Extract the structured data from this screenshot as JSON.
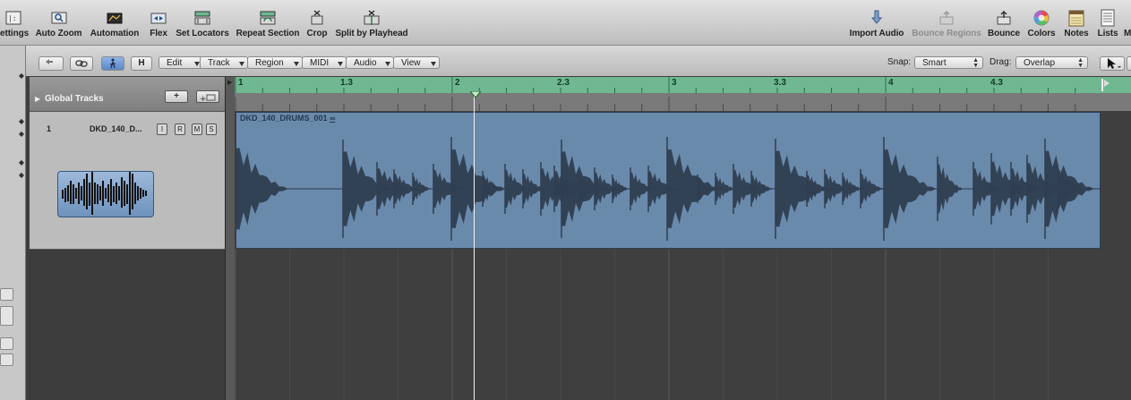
{
  "toolbar": {
    "items": [
      {
        "label": "ettings",
        "icon": "settings-icon"
      },
      {
        "label": "Auto Zoom",
        "icon": "auto-zoom-icon"
      },
      {
        "label": "Automation",
        "icon": "automation-icon"
      },
      {
        "label": "Flex",
        "icon": "flex-icon"
      },
      {
        "label": "Set Locators",
        "icon": "set-locators-icon"
      },
      {
        "label": "Repeat Section",
        "icon": "repeat-section-icon"
      },
      {
        "label": "Crop",
        "icon": "crop-icon"
      },
      {
        "label": "Split by Playhead",
        "icon": "split-icon"
      },
      {
        "label": "Import Audio",
        "icon": "import-audio-icon"
      },
      {
        "label": "Bounce Regions",
        "icon": "bounce-regions-icon"
      },
      {
        "label": "Bounce",
        "icon": "bounce-icon"
      },
      {
        "label": "Colors",
        "icon": "colors-icon"
      },
      {
        "label": "Notes",
        "icon": "notes-icon"
      },
      {
        "label": "Lists",
        "icon": "lists-icon"
      },
      {
        "label": "M",
        "icon": "media-icon"
      }
    ]
  },
  "secondary": {
    "h_label": "H",
    "menus": [
      "Edit",
      "Track",
      "Region",
      "MIDI",
      "Audio",
      "View"
    ],
    "snap_label": "Snap:",
    "snap_value": "Smart",
    "drag_label": "Drag:",
    "drag_value": "Overlap"
  },
  "global_tracks": {
    "label": "Global Tracks",
    "add_label": "+"
  },
  "track": {
    "number": "1",
    "name": "DKD_140_D...",
    "buttons": [
      "I",
      "R",
      "M",
      "S"
    ]
  },
  "ruler": {
    "marks": [
      {
        "bar": 1,
        "label": "1"
      },
      {
        "bar": 1.5,
        "label": "1.3"
      },
      {
        "bar": 2,
        "label": "2"
      },
      {
        "bar": 2.5,
        "label": "2.3"
      },
      {
        "bar": 3,
        "label": "3"
      },
      {
        "bar": 3.5,
        "label": "3.3"
      },
      {
        "bar": 4,
        "label": "4"
      },
      {
        "bar": 4.5,
        "label": "4.3"
      }
    ],
    "playhead_bar": 2.1
  },
  "region": {
    "name": "DKD_140_DRUMS_001"
  },
  "colors": {
    "ruler": "#6fb892",
    "region": "#6a8aac",
    "waveform": "#2f3e50",
    "playhead": "#f2f2f2"
  }
}
